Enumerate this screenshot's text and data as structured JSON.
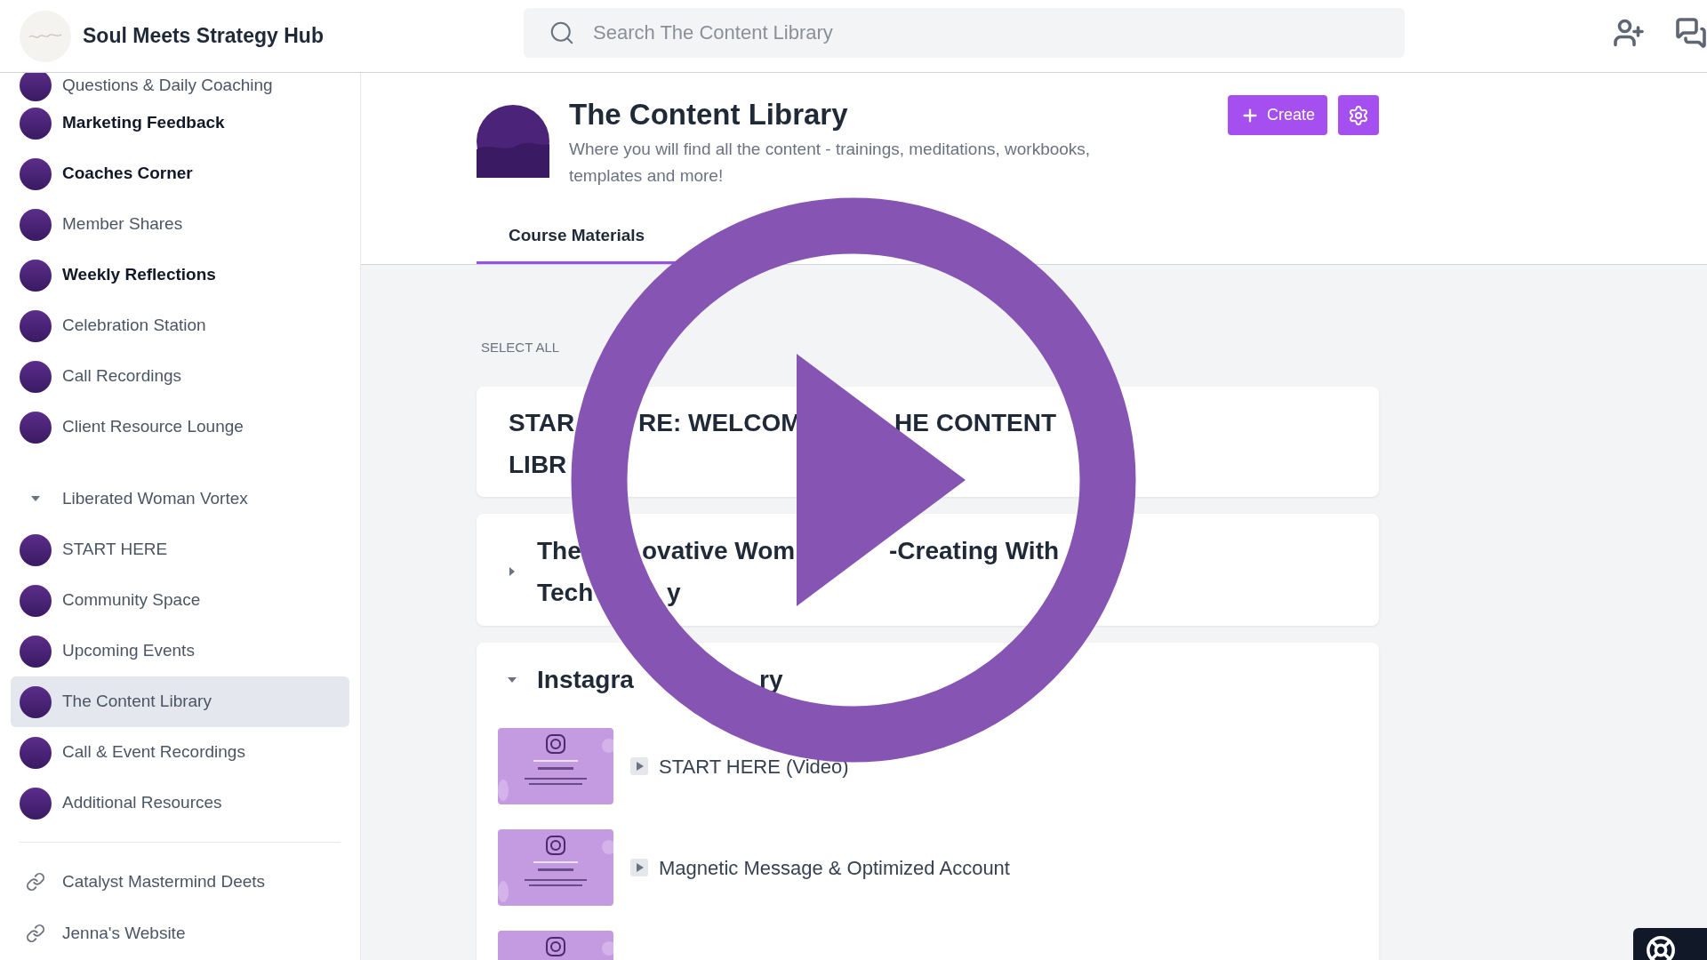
{
  "header": {
    "title": "Soul Meets Strategy Hub",
    "search": {
      "placeholder": "Search The Content Library"
    }
  },
  "sidebar": {
    "items": [
      {
        "kind": "space",
        "label": "Questions & Daily Coaching",
        "unread": false,
        "selected": false
      },
      {
        "kind": "space",
        "label": "Marketing Feedback",
        "unread": true,
        "selected": false
      },
      {
        "kind": "space",
        "label": "Coaches Corner",
        "unread": true,
        "selected": false
      },
      {
        "kind": "space",
        "label": "Member Shares",
        "unread": false,
        "selected": false
      },
      {
        "kind": "space",
        "label": "Weekly Reflections",
        "unread": true,
        "selected": false
      },
      {
        "kind": "space",
        "label": "Celebration Station",
        "unread": false,
        "selected": false
      },
      {
        "kind": "space",
        "label": "Call Recordings",
        "unread": false,
        "selected": false
      },
      {
        "kind": "space",
        "label": "Client Resource Lounge",
        "unread": false,
        "selected": false
      },
      {
        "kind": "group",
        "label": "Liberated Woman Vortex",
        "expanded": true,
        "children": [
          {
            "kind": "space",
            "label": "START HERE",
            "unread": false,
            "selected": false
          },
          {
            "kind": "space",
            "label": "Community Space",
            "unread": false,
            "selected": false
          },
          {
            "kind": "space",
            "label": "Upcoming Events",
            "unread": false,
            "selected": false
          },
          {
            "kind": "space",
            "label": "The Content Library",
            "unread": false,
            "selected": true
          },
          {
            "kind": "space",
            "label": "Call & Event Recordings",
            "unread": false,
            "selected": false
          },
          {
            "kind": "space",
            "label": "Additional Resources",
            "unread": false,
            "selected": false
          }
        ]
      }
    ],
    "links": [
      {
        "label": "Catalyst Mastermind Deets"
      },
      {
        "label": "Jenna's Website"
      }
    ]
  },
  "page": {
    "title": "The Content Library",
    "description": "Where you will find all the content - trainings, meditations, workbooks, templates and more!",
    "actions": [
      {
        "kind": "create",
        "label": "Create"
      },
      {
        "kind": "settings"
      }
    ],
    "tabs": [
      {
        "label": "Course Materials",
        "selected": true
      }
    ],
    "select_all": "SELECT ALL",
    "sections": [
      {
        "kind": "heading",
        "title_lines": [
          [
            "STAR",
            "RE: WELCOM",
            "HE CONTENT"
          ],
          [
            "LIBR"
          ]
        ]
      },
      {
        "kind": "folder",
        "expanded": false,
        "title_lines": [
          [
            "The",
            "ovative Wom",
            "-Creating With"
          ],
          [
            "Tech",
            "y"
          ]
        ]
      },
      {
        "kind": "folder",
        "expanded": true,
        "title_lines": [
          [
            "Instagra",
            "ry"
          ]
        ],
        "lessons": [
          {
            "kind": "lesson",
            "title": "START HERE (Video)"
          },
          {
            "kind": "lesson",
            "title": "Magnetic Message & Optimized Account"
          },
          {
            "kind": "thumbnail"
          }
        ]
      }
    ]
  }
}
